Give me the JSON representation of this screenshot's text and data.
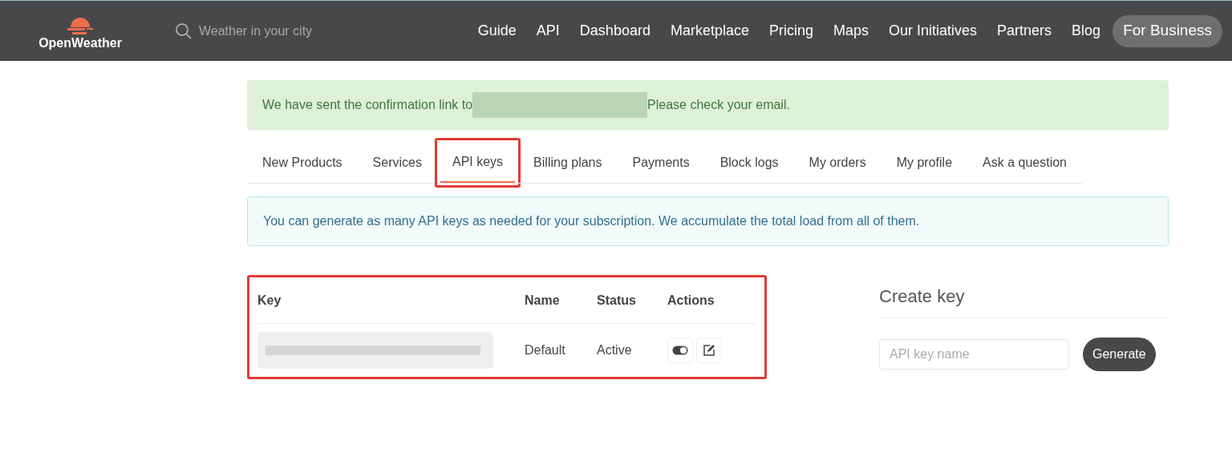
{
  "header": {
    "logo": "OpenWeather",
    "search": {
      "placeholder": "Weather in your city"
    },
    "nav": [
      {
        "label": "Guide",
        "kind": "link"
      },
      {
        "label": "API",
        "kind": "link"
      },
      {
        "label": "Dashboard",
        "kind": "link"
      },
      {
        "label": "Marketplace",
        "kind": "link"
      },
      {
        "label": "Pricing",
        "kind": "link"
      },
      {
        "label": "Maps",
        "kind": "link"
      },
      {
        "label": "Our Initiatives",
        "kind": "link"
      },
      {
        "label": "Partners",
        "kind": "link"
      },
      {
        "label": "Blog",
        "kind": "link"
      },
      {
        "label": "For Business",
        "kind": "pill"
      }
    ]
  },
  "alert": {
    "before": "We have sent the confirmation link to",
    "after": "Please check your email."
  },
  "tabs": [
    {
      "label": "New Products",
      "selected": false,
      "highlighted": false
    },
    {
      "label": "Services",
      "selected": false,
      "highlighted": false
    },
    {
      "label": "API keys",
      "selected": true,
      "highlighted": true
    },
    {
      "label": "Billing plans",
      "selected": false,
      "highlighted": false
    },
    {
      "label": "Payments",
      "selected": false,
      "highlighted": false
    },
    {
      "label": "Block logs",
      "selected": false,
      "highlighted": false
    },
    {
      "label": "My orders",
      "selected": false,
      "highlighted": false
    },
    {
      "label": "My profile",
      "selected": false,
      "highlighted": false
    },
    {
      "label": "Ask a question",
      "selected": false,
      "highlighted": false
    }
  ],
  "info": "You can generate as many API keys as needed for your subscription. We accumulate the total load from all of them.",
  "table": {
    "highlighted": true,
    "columns": [
      "Key",
      "Name",
      "Status",
      "Actions"
    ],
    "rows": [
      {
        "name": "Default",
        "status": "Active",
        "enabled": true
      }
    ]
  },
  "create_key": {
    "title": "Create key",
    "field": {
      "placeholder": "API key name"
    },
    "button": "Generate"
  }
}
